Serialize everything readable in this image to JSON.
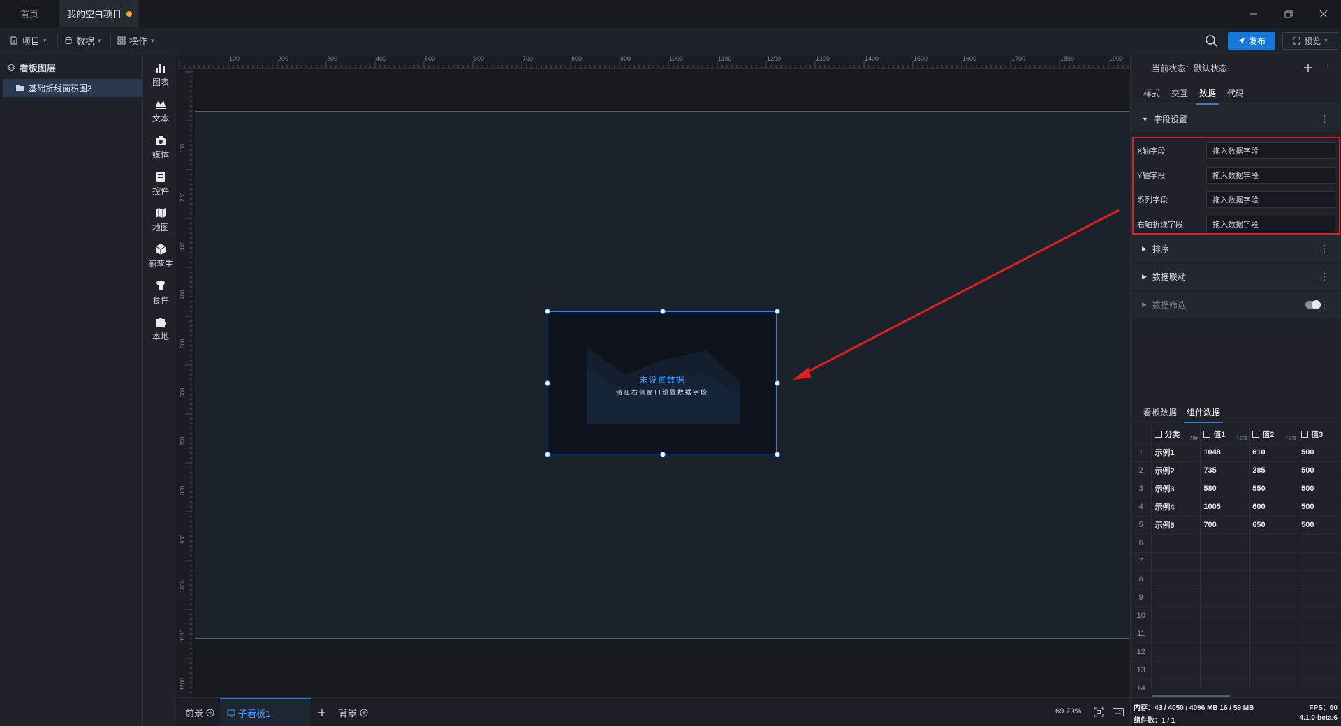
{
  "titlebar": {
    "tabs": [
      {
        "label": "首页"
      },
      {
        "label": "我的空白项目"
      }
    ],
    "unsaved_color": "#f5a623",
    "controls": {
      "minimize_icon": "minimize-icon",
      "restore_icon": "restore-icon",
      "close_icon": "close-icon"
    }
  },
  "menubar": {
    "items": [
      {
        "label": "项目"
      },
      {
        "label": "数据"
      },
      {
        "label": "操作"
      }
    ],
    "publish_label": "发布",
    "preview_label": "预览",
    "accent": "#1677d9"
  },
  "layers": {
    "title": "看板图层",
    "items": [
      {
        "label": "基础折线面积图3"
      }
    ]
  },
  "tools": [
    {
      "label": "图表",
      "icon": "chart-icon"
    },
    {
      "label": "文本",
      "icon": "text-icon"
    },
    {
      "label": "媒体",
      "icon": "media-icon"
    },
    {
      "label": "控件",
      "icon": "widget-icon"
    },
    {
      "label": "地图",
      "icon": "map-icon"
    },
    {
      "label": "鲸孪生",
      "icon": "cube-icon"
    },
    {
      "label": "套件",
      "icon": "suite-icon"
    },
    {
      "label": "本地",
      "icon": "puzzle-icon"
    }
  ],
  "canvas": {
    "ruler_top": [
      "100",
      "200",
      "300",
      "400",
      "500",
      "600",
      "700",
      "800",
      "900",
      "1000",
      "1100",
      "1200",
      "1300",
      "1400",
      "1500",
      "1600",
      "1700",
      "1800",
      "1900"
    ],
    "ruler_left": [
      "100",
      "200",
      "300",
      "400",
      "500",
      "600",
      "700",
      "800",
      "900",
      "1000",
      "1100",
      "1200"
    ],
    "widget": {
      "title": "未设置数据",
      "subtitle": "请在右侧窗口设置数据字段"
    }
  },
  "bottombar": {
    "tabs": [
      {
        "label": "前景"
      },
      {
        "label": "子看板1"
      },
      {
        "label": "背景"
      }
    ],
    "zoom": "69.79%"
  },
  "rightpanel": {
    "state_label": "当前状态：",
    "state_value": "默认状态",
    "tabs": [
      {
        "label": "样式"
      },
      {
        "label": "交互"
      },
      {
        "label": "数据"
      },
      {
        "label": "代码"
      }
    ],
    "field_section": "字段设置",
    "fields": [
      {
        "label": "X轴字段",
        "placeholder": "拖入数据字段"
      },
      {
        "label": "Y轴字段",
        "placeholder": "拖入数据字段"
      },
      {
        "label": "系列字段",
        "placeholder": "拖入数据字段"
      },
      {
        "label": "右轴折线字段",
        "placeholder": "拖入数据字段"
      }
    ],
    "sections": [
      {
        "label": "排序"
      },
      {
        "label": "数据联动"
      },
      {
        "label": "数据筛选"
      }
    ],
    "data_tabs": [
      {
        "label": "看板数据"
      },
      {
        "label": "组件数据"
      }
    ],
    "table": {
      "columns": [
        {
          "name": "分类",
          "type": "Str"
        },
        {
          "name": "值1",
          "type": "123"
        },
        {
          "name": "值2",
          "type": "123"
        },
        {
          "name": "值3",
          "type": ""
        }
      ],
      "rows": [
        [
          "示例1",
          "1048",
          "610",
          "500"
        ],
        [
          "示例2",
          "735",
          "285",
          "500"
        ],
        [
          "示例3",
          "580",
          "550",
          "500"
        ],
        [
          "示例4",
          "1005",
          "600",
          "500"
        ],
        [
          "示例5",
          "700",
          "650",
          "500"
        ]
      ],
      "row_numbers": [
        "1",
        "2",
        "3",
        "4",
        "5",
        "6",
        "7",
        "8",
        "9",
        "10",
        "11",
        "12",
        "13",
        "14"
      ]
    },
    "status": {
      "memory": "内存：43 / 4050 / 4096 MB 16 / 59 MB",
      "fps": "FPS：60",
      "components": "组件数：1 / 1",
      "version": "4.1.0-beta.6"
    }
  }
}
